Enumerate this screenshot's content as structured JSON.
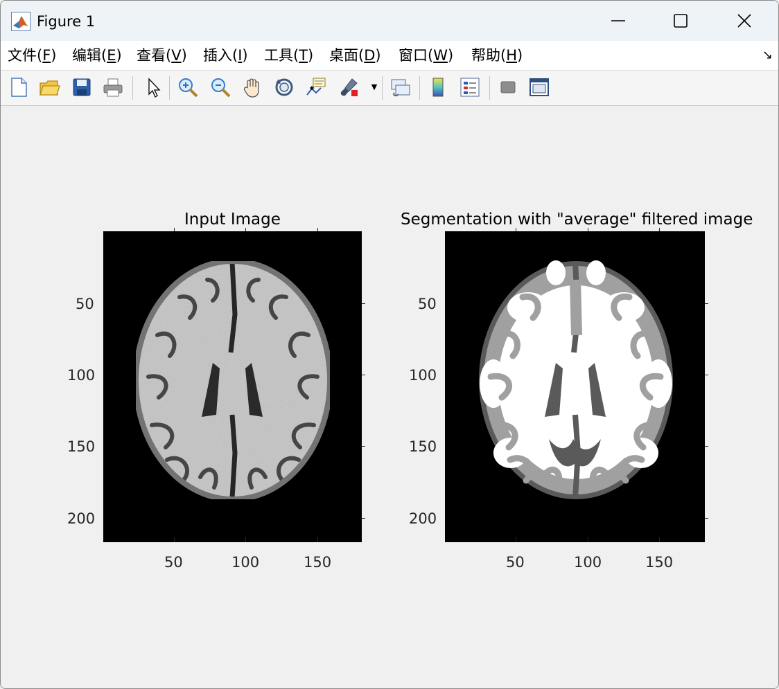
{
  "window": {
    "title": "Figure 1"
  },
  "menu": {
    "items": [
      "文件(F)",
      "编辑(E)",
      "查看(V)",
      "插入(I)",
      "工具(T)",
      "桌面(D)",
      "窗口(W)",
      "帮助(H)"
    ],
    "mnemonics": [
      "F",
      "E",
      "V",
      "I",
      "T",
      "D",
      "W",
      "H"
    ]
  },
  "toolbar": {
    "icons": [
      "new-figure-icon",
      "open-file-icon",
      "save-icon",
      "print-icon",
      "edit-plot-arrow-icon",
      "zoom-in-icon",
      "zoom-out-icon",
      "pan-hand-icon",
      "rotate-3d-icon",
      "data-cursor-icon",
      "brush-icon",
      "link-plot-icon",
      "colorbar-icon",
      "legend-icon",
      "hide-plot-tools-icon",
      "show-plot-tools-icon"
    ]
  },
  "plots": [
    {
      "title": "Input Image",
      "xticks": [
        "50",
        "100",
        "150"
      ],
      "yticks": [
        "50",
        "100",
        "150",
        "200"
      ]
    },
    {
      "title": "Segmentation with \"average\" filtered image",
      "xticks": [
        "50",
        "100",
        "150"
      ],
      "yticks": [
        "50",
        "100",
        "150",
        "200"
      ]
    }
  ],
  "colors": {
    "titlebar": "#eef3f8",
    "background": "#f0f0f0",
    "image_background": "#000000",
    "wm_gray": "#c8c8c8",
    "seg_white": "#ffffff",
    "seg_light_gray": "#a0a0a0",
    "seg_dark_gray": "#5a5a5a"
  }
}
